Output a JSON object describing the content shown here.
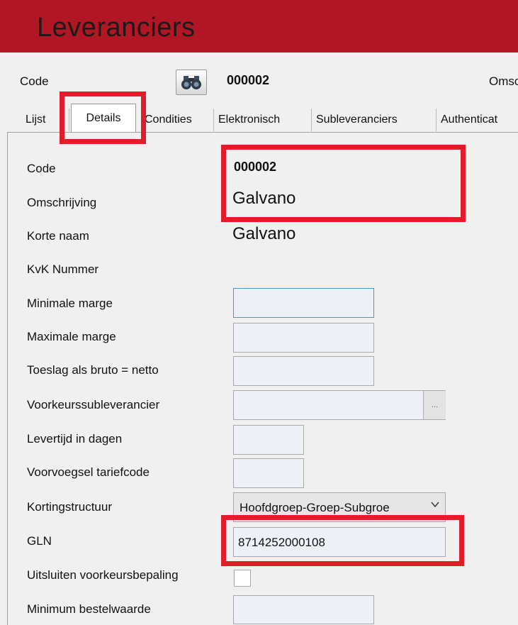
{
  "window": {
    "title": "Leveranciers"
  },
  "header": {
    "code_label": "Code",
    "code_value": "000002",
    "omschrijving_label_partial": "Omsc"
  },
  "tabs": [
    {
      "label": "Lijst",
      "active": false
    },
    {
      "label": "Details",
      "active": true
    },
    {
      "label": "Condities",
      "active": false
    },
    {
      "label": "Elektronisch",
      "active": false
    },
    {
      "label": "Subleveranciers",
      "active": false
    },
    {
      "label": "Authenticat",
      "active": false
    }
  ],
  "form": {
    "code": {
      "label": "Code",
      "value": "000002"
    },
    "omschrijving": {
      "label": "Omschrijving",
      "value": "Galvano"
    },
    "korte_naam": {
      "label": "Korte naam",
      "value": "Galvano"
    },
    "kvk": {
      "label": "KvK Nummer",
      "value": ""
    },
    "minimale_marge": {
      "label": "Minimale marge",
      "value": ""
    },
    "maximale_marge": {
      "label": "Maximale marge",
      "value": ""
    },
    "toeslag": {
      "label": "Toeslag als bruto = netto",
      "value": ""
    },
    "voorkeurssubleverancier": {
      "label": "Voorkeurssubleverancier",
      "value": "",
      "button": "..."
    },
    "levertijd": {
      "label": "Levertijd in dagen",
      "value": ""
    },
    "voorvoegsel": {
      "label": "Voorvoegsel tariefcode",
      "value": ""
    },
    "kortingstructuur": {
      "label": "Kortingstructuur",
      "value": "Hoofdgroep-Groep-Subgroe"
    },
    "gln": {
      "label": "GLN",
      "value": "8714252000108"
    },
    "uitsluiten": {
      "label": "Uitsluiten voorkeursbepaling",
      "checked": false
    },
    "minimum_bestelwaarde": {
      "label": "Minimum bestelwaarde",
      "value": ""
    }
  },
  "colors": {
    "title_bar": "#b01623",
    "highlight": "#e41c2a",
    "input_bg": "#edf1f7"
  }
}
